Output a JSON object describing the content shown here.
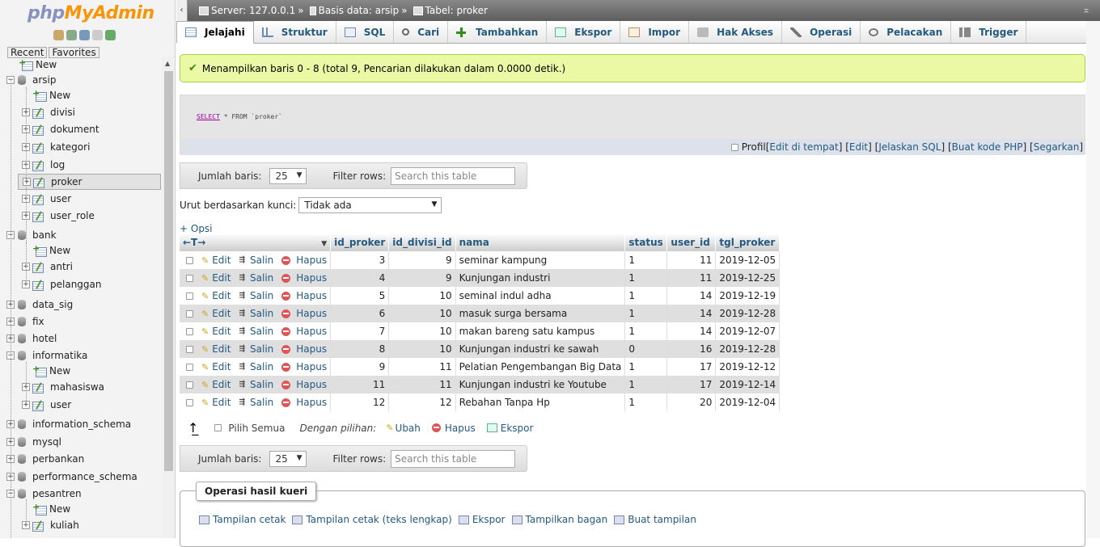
{
  "sidebar": {
    "logo_php": "php",
    "logo_my": "MyAdmin",
    "recent_label": "Recent",
    "favorites_label": "Favorites",
    "tree": [
      {
        "label": "New",
        "kind": "new",
        "level": 0
      },
      {
        "label": "arsip",
        "kind": "db",
        "level": 0,
        "expand": "−"
      },
      {
        "label": "New",
        "kind": "new",
        "level": 1
      },
      {
        "label": "divisi",
        "kind": "table",
        "level": 1,
        "expand": "+"
      },
      {
        "label": "dokument",
        "kind": "table",
        "level": 1,
        "expand": "+"
      },
      {
        "label": "kategori",
        "kind": "table",
        "level": 1,
        "expand": "+"
      },
      {
        "label": "log",
        "kind": "table",
        "level": 1,
        "expand": "+"
      },
      {
        "label": "proker",
        "kind": "table",
        "level": 1,
        "expand": "+",
        "selected": true
      },
      {
        "label": "user",
        "kind": "table",
        "level": 1,
        "expand": "+"
      },
      {
        "label": "user_role",
        "kind": "table",
        "level": 1,
        "expand": "+"
      },
      {
        "label": "bank",
        "kind": "db",
        "level": 0,
        "expand": "−"
      },
      {
        "label": "New",
        "kind": "new",
        "level": 1
      },
      {
        "label": "antri",
        "kind": "table",
        "level": 1,
        "expand": "+"
      },
      {
        "label": "pelanggan",
        "kind": "table",
        "level": 1,
        "expand": "+"
      },
      {
        "label": "data_sig",
        "kind": "db",
        "level": 0,
        "expand": "+"
      },
      {
        "label": "fix",
        "kind": "db",
        "level": 0,
        "expand": "+"
      },
      {
        "label": "hotel",
        "kind": "db",
        "level": 0,
        "expand": "+"
      },
      {
        "label": "informatika",
        "kind": "db",
        "level": 0,
        "expand": "−"
      },
      {
        "label": "New",
        "kind": "new",
        "level": 1
      },
      {
        "label": "mahasiswa",
        "kind": "table",
        "level": 1,
        "expand": "+"
      },
      {
        "label": "user",
        "kind": "table",
        "level": 1,
        "expand": "+"
      },
      {
        "label": "information_schema",
        "kind": "db",
        "level": 0,
        "expand": "+"
      },
      {
        "label": "mysql",
        "kind": "db",
        "level": 0,
        "expand": "+"
      },
      {
        "label": "perbankan",
        "kind": "db",
        "level": 0,
        "expand": "+"
      },
      {
        "label": "performance_schema",
        "kind": "db",
        "level": 0,
        "expand": "+"
      },
      {
        "label": "pesantren",
        "kind": "db",
        "level": 0,
        "expand": "−"
      },
      {
        "label": "New",
        "kind": "new",
        "level": 1
      },
      {
        "label": "kuliah",
        "kind": "table",
        "level": 1,
        "expand": "+"
      }
    ]
  },
  "breadcrumb": {
    "server": "Server: 127.0.0.1",
    "database": "Basis data: arsip",
    "table": "Tabel: proker",
    "sep": "»"
  },
  "tabs": [
    {
      "label": "Jelajahi",
      "icon": "table-icon",
      "cls": "ico-table",
      "active": true
    },
    {
      "label": "Struktur",
      "icon": "structure-icon",
      "cls": "ico-struct"
    },
    {
      "label": "SQL",
      "icon": "sql-icon",
      "cls": "ico-sql"
    },
    {
      "label": "Cari",
      "icon": "search-icon",
      "cls": "ico-search"
    },
    {
      "label": "Tambahkan",
      "icon": "insert-icon",
      "cls": "ico-insert"
    },
    {
      "label": "Ekspor",
      "icon": "export-icon",
      "cls": "ico-export"
    },
    {
      "label": "Impor",
      "icon": "import-icon",
      "cls": "ico-import"
    },
    {
      "label": "Hak Akses",
      "icon": "privileges-icon",
      "cls": "ico-priv"
    },
    {
      "label": "Operasi",
      "icon": "wrench-icon",
      "cls": "ico-ops"
    },
    {
      "label": "Pelacakan",
      "icon": "eye-icon",
      "cls": "ico-track"
    },
    {
      "label": "Trigger",
      "icon": "trigger-icon",
      "cls": "ico-trig"
    }
  ],
  "success_message": "Menampilkan baris 0 - 8 (total 9, Pencarian dilakukan dalam 0.0000 detik.)",
  "sql": {
    "select_kw": "SELECT",
    "rest": " * FROM `proker`",
    "profil_label": "Profil",
    "links": [
      "Edit di tempat",
      "Edit",
      "Jelaskan SQL",
      "Buat kode PHP",
      "Segarkan"
    ]
  },
  "nav": {
    "rows_label": "Jumlah baris:",
    "rows_value": "25",
    "filter_label": "Filter rows:",
    "filter_placeholder": "Search this table"
  },
  "sort": {
    "label": "Urut berdasarkan kunci:",
    "value": "Tidak ada"
  },
  "opsi_label": "+ Opsi",
  "grid": {
    "arrows": "←T→",
    "columns": [
      "id_proker",
      "id_divisi_id",
      "nama",
      "status",
      "user_id",
      "tgl_proker"
    ],
    "actions": {
      "edit": "Edit",
      "copy": "Salin",
      "delete": "Hapus"
    },
    "rows": [
      [
        "3",
        "9",
        "seminar kampung",
        "1",
        "11",
        "2019-12-05"
      ],
      [
        "4",
        "9",
        "Kunjungan industri",
        "1",
        "11",
        "2019-12-25"
      ],
      [
        "5",
        "10",
        "seminal indul adha",
        "1",
        "14",
        "2019-12-19"
      ],
      [
        "6",
        "10",
        "masuk surga bersama",
        "1",
        "14",
        "2019-12-28"
      ],
      [
        "7",
        "10",
        "makan bareng satu kampus",
        "1",
        "14",
        "2019-12-07"
      ],
      [
        "8",
        "10",
        "Kunjungan industri ke sawah",
        "0",
        "16",
        "2019-12-28"
      ],
      [
        "9",
        "11",
        "Pelatian Pengembangan Big Data",
        "1",
        "17",
        "2019-12-12"
      ],
      [
        "11",
        "11",
        "Kunjungan industri ke Youtube",
        "1",
        "17",
        "2019-12-14"
      ],
      [
        "12",
        "12",
        "Rebahan Tanpa Hp",
        "1",
        "20",
        "2019-12-04"
      ]
    ]
  },
  "with_selected": {
    "select_all": "Pilih Semua",
    "with_label": "Dengan pilihan:",
    "change": "Ubah",
    "delete": "Hapus",
    "export": "Ekspor"
  },
  "query_ops": {
    "legend": "Operasi hasil kueri",
    "links": [
      "Tampilan cetak",
      "Tampilan cetak (teks lengkap)",
      "Ekspor",
      "Tampilkan bagan",
      "Buat tampilan"
    ]
  }
}
